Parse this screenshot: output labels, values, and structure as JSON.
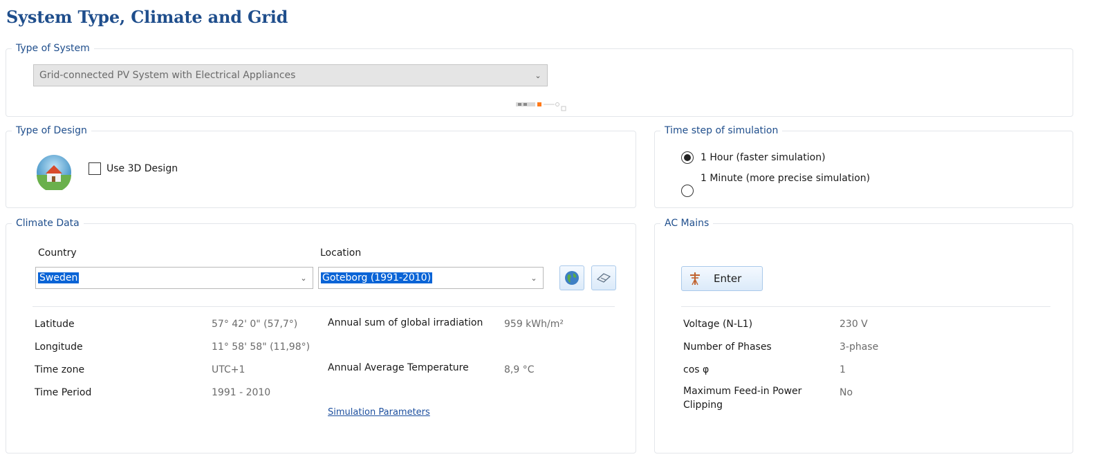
{
  "page": {
    "title": "System Type, Climate and Grid"
  },
  "type_of_system": {
    "title": "Type of System",
    "selected": "Grid-connected PV System with Electrical Appliances"
  },
  "type_of_design": {
    "title": "Type of Design",
    "checkbox_label": "Use 3D Design",
    "checked": false
  },
  "time_step": {
    "title": "Time step of simulation",
    "options": [
      {
        "label": "1 Hour (faster simulation)",
        "selected": true
      },
      {
        "label": "1 Minute (more precise simulation)",
        "selected": false
      }
    ]
  },
  "climate": {
    "title": "Climate Data",
    "country_label": "Country",
    "country_value": "Sweden",
    "location_label": "Location",
    "location_value": "Goteborg (1991-2010)",
    "rows": [
      {
        "label": "Latitude",
        "value": "57° 42' 0\"  (57,7°)"
      },
      {
        "label": "Longitude",
        "value": "11° 58' 58\"  (11,98°)"
      },
      {
        "label": "Time zone",
        "value": "UTC+1"
      },
      {
        "label": "Time Period",
        "value": "1991 - 2010"
      }
    ],
    "irradiation_label": "Annual sum of global irradiation",
    "irradiation_value": "959 kWh/m²",
    "temperature_label": "Annual Average Temperature",
    "temperature_value": "8,9 °C",
    "link": "Simulation Parameters"
  },
  "ac_mains": {
    "title": "AC Mains",
    "enter_label": "Enter",
    "rows": [
      {
        "label": "Voltage (N-L1)",
        "value": "230 V"
      },
      {
        "label": "Number of Phases",
        "value": "3-phase"
      },
      {
        "label": "cos φ",
        "value": "1"
      },
      {
        "label": "Maximum Feed-in Power\nClipping",
        "value": "No"
      }
    ]
  },
  "colors": {
    "accent": "#1f4e8c",
    "selection": "#0a64d6",
    "border": "#e3e6ea"
  }
}
